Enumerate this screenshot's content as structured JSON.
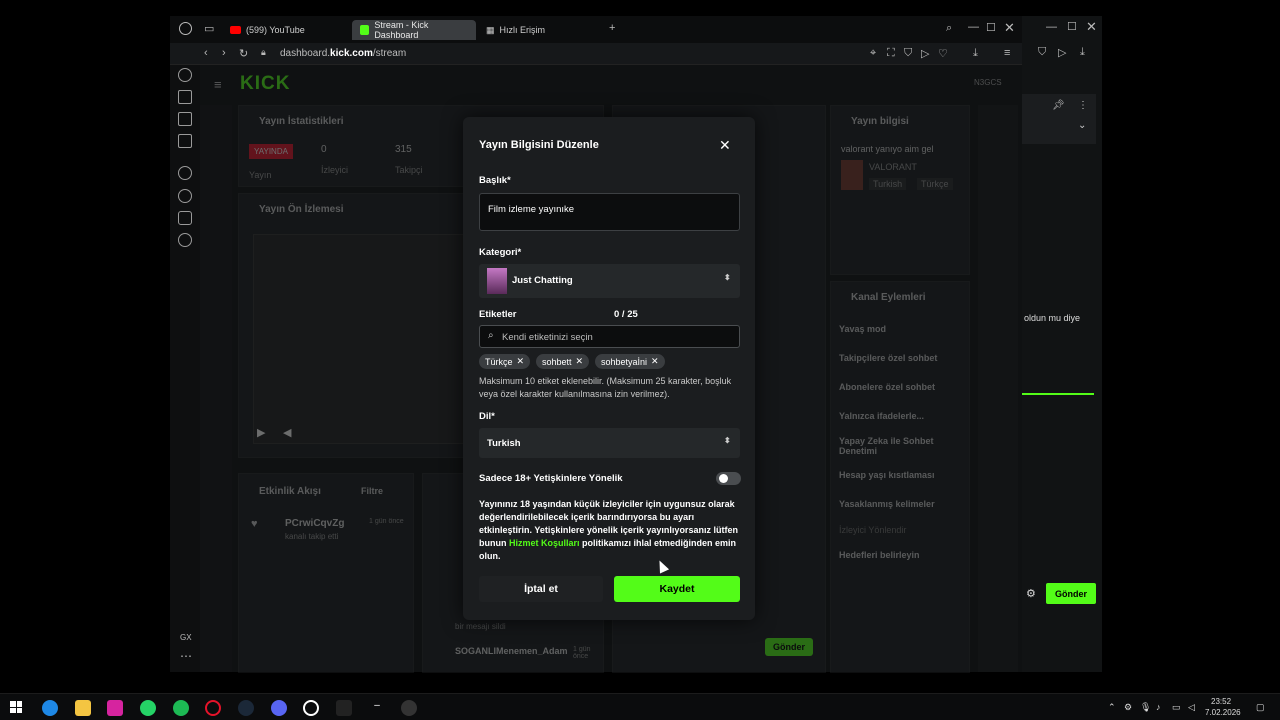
{
  "browser": {
    "tabs": [
      {
        "label": "(599) YouTube",
        "active": false
      },
      {
        "label": "Stream - Kick Dashboard",
        "active": true
      },
      {
        "label": "Hızlı Erişim",
        "active": false
      }
    ],
    "url_prefix": "dashboard.",
    "url_host": "kick.com",
    "url_path": "/stream",
    "gx_label": "GX"
  },
  "dashboard": {
    "logo": "KICK",
    "user_tag": "N3GCS",
    "stats_title": "Yayın İstatistikleri",
    "live_badge": "YAYINDA",
    "stream_label": "Yayın",
    "viewers_value": "0",
    "viewers_label": "İzleyici",
    "followers_value": "315",
    "followers_label": "Takipçi",
    "preview_title": "Yayın Ön İzlemesi",
    "activity_title": "Etkinlik Akışı",
    "filter_label": "Filtre",
    "activity_user": "PCrwiCqvZg",
    "activity_time": "1 gün önce",
    "activity_desc": "kanalı takip etti",
    "deleted_user": "SOGANLIMenemen_Adam",
    "deleted_time": "1 gün önce",
    "deleted_desc": "bir mesajı sildi",
    "stream_info_title": "Yayın bilgisi",
    "stream_info_text": "valorant yanıyo aim gel",
    "stream_info_game": "VALORANT",
    "stream_info_tag1": "Turkish",
    "stream_info_tag2": "Türkçe",
    "channel_actions_title": "Kanal Eylemleri",
    "actions": [
      "Yavaş mod",
      "Takipçilere özel sohbet",
      "Abonelere özel sohbet",
      "Yalnızca ifadelerle...",
      "Yapay Zeka ile Sohbet Denetimi",
      "Hesap yaşı kısıtlaması",
      "Yasaklanmış kelimeler",
      "İzleyici Yönlendir",
      "Hedefleri belirleyin"
    ],
    "send_label": "Gönder"
  },
  "modal": {
    "title": "Yayın Bilgisini Düzenle",
    "title_label": "Başlık*",
    "title_value": "Film izleme yayınıke",
    "category_label": "Kategori*",
    "category_value": "Just Chatting",
    "tags_label": "Etiketler",
    "tags_count": "0 / 25",
    "tags_placeholder": "Kendi etiketinizi seçin",
    "tags": [
      "Türkçe",
      "sohbett",
      "sohbetyaİni"
    ],
    "tags_help": "Maksimum 10 etiket eklenebilir. (Maksimum 25 karakter, boşluk veya özel karakter kullanılmasına izin verilmez).",
    "language_label": "Dil*",
    "language_value": "Turkish",
    "adult_label": "Sadece 18+ Yetişkinlere Yönelik",
    "adult_on": false,
    "warning_part1": "Yayınınız 18 yaşından küçük izleyiciler için uygunsuz olarak değerlendirilebilecek içerik barındırıyorsa bu ayarı etkinleştirin. Yetişkinlere yönelik içerik yayınlıyorsanız lütfen bunun ",
    "warning_link": "Hizmet Koşulları",
    "warning_part2": " politikamızı ihlal etmediğinden emin olun.",
    "cancel_label": "İptal et",
    "save_label": "Kaydet"
  },
  "window2": {
    "chat_snippet": "oldun mu diye",
    "send_label": "Gönder"
  },
  "taskbar": {
    "time": "23:52",
    "date": "7.02.2026"
  },
  "colors": {
    "accent": "#53fc18",
    "live": "#e5132a"
  }
}
